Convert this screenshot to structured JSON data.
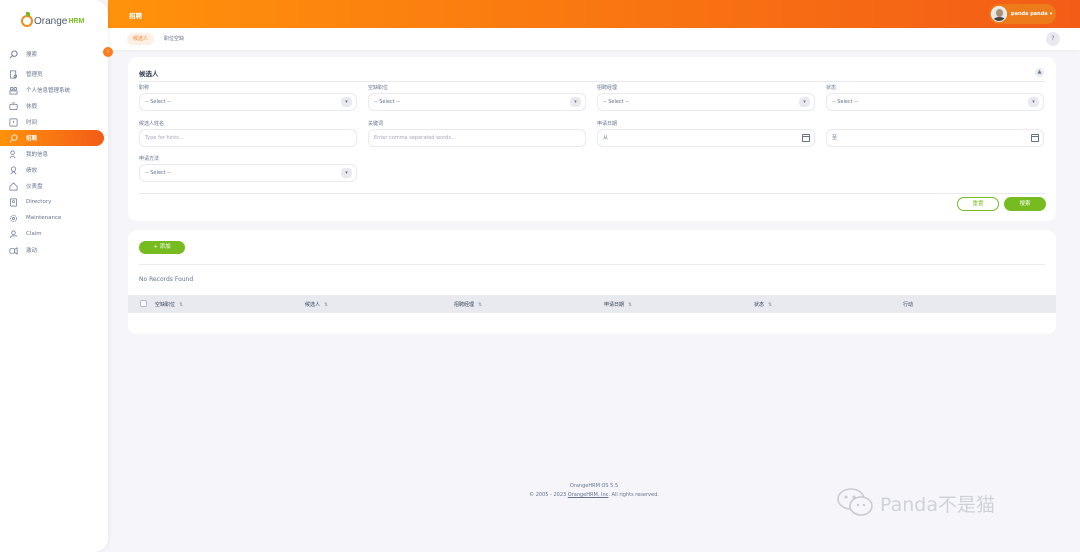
{
  "sidebar": {
    "logo_main": "Orange",
    "logo_sub": "HRM",
    "search_label": "搜索",
    "items": [
      {
        "label": "管理员",
        "icon": "admin-icon"
      },
      {
        "label": "个人信息管理系统",
        "icon": "pim-icon"
      },
      {
        "label": "休假",
        "icon": "leave-icon"
      },
      {
        "label": "时间",
        "icon": "time-icon"
      },
      {
        "label": "招聘",
        "icon": "recruitment-icon",
        "active": true
      },
      {
        "label": "我的信息",
        "icon": "my-info-icon"
      },
      {
        "label": "绩效",
        "icon": "performance-icon"
      },
      {
        "label": "仪表盘",
        "icon": "dashboard-icon"
      },
      {
        "label": "Directory",
        "icon": "directory-icon"
      },
      {
        "label": "Maintenance",
        "icon": "maintenance-icon"
      },
      {
        "label": "Claim",
        "icon": "claim-icon"
      },
      {
        "label": "激动",
        "icon": "buzz-icon"
      }
    ]
  },
  "topbar": {
    "title": "招聘",
    "user_name": "panda panda"
  },
  "tabs": {
    "candidates": "候选人",
    "vacancies": "职位空缺",
    "help": "?"
  },
  "filter": {
    "title": "候选人",
    "job_title_label": "职称",
    "job_title_value": "-- Select --",
    "vacancy_label": "空缺职位",
    "vacancy_value": "-- Select --",
    "hiring_manager_label": "招聘经理",
    "hiring_manager_value": "-- Select --",
    "status_label": "状态",
    "status_value": "-- Select --",
    "candidate_name_label": "候选人姓名",
    "candidate_name_placeholder": "Type for hints...",
    "keywords_label": "关键词",
    "keywords_placeholder": "Enter comma seperated words...",
    "date_label": "申请日期",
    "date_from": "从",
    "date_to": "至",
    "method_label": "申请方法",
    "method_value": "-- Select --",
    "reset_label": "重置",
    "search_label": "搜索"
  },
  "list": {
    "add_label": "+ 添加",
    "empty_text": "No Records Found",
    "columns": [
      "空缺职位",
      "候选人",
      "招聘经理",
      "申请日期",
      "状态",
      "行动"
    ]
  },
  "footer": {
    "line1": "OrangeHRM OS 5.5",
    "line2_prefix": "© 2005 - 2023 ",
    "line2_link": "OrangeHRM, Inc",
    "line2_suffix": ". All rights reserved."
  },
  "watermark": {
    "text": "Panda不是猫"
  },
  "colors": {
    "accent": "#ff7b1d",
    "green": "#76bc21",
    "text": "#64728c"
  }
}
